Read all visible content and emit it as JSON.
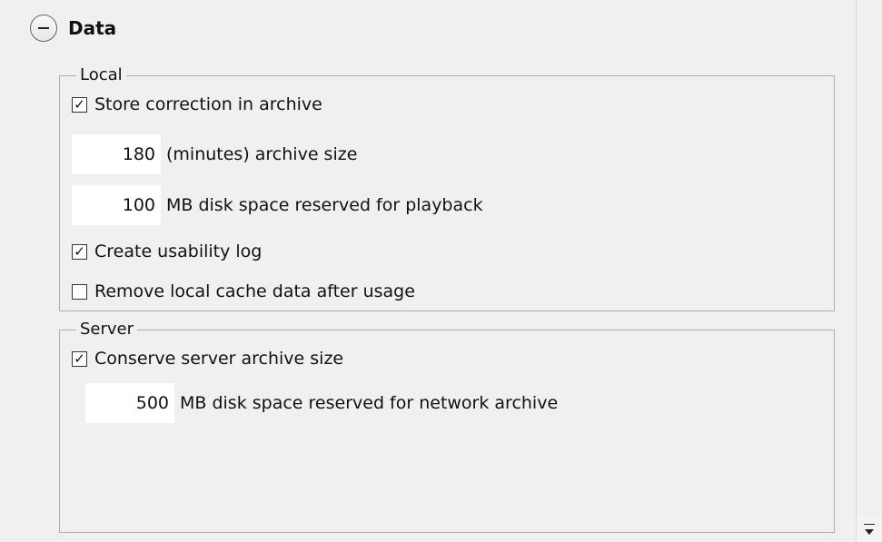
{
  "section": {
    "title": "Data",
    "collapse_icon": "minus-circle-icon"
  },
  "local": {
    "legend": "Local",
    "store_correction": {
      "label": "Store correction in archive",
      "checked": true
    },
    "archive_size": {
      "value": "180",
      "label": "(minutes) archive size"
    },
    "playback_space": {
      "value": "100",
      "label": "MB disk space reserved for playback"
    },
    "usability_log": {
      "label": "Create usability log",
      "checked": true
    },
    "remove_cache": {
      "label": "Remove local cache data after usage",
      "checked": false
    }
  },
  "server": {
    "legend": "Server",
    "conserve_archive": {
      "label": "Conserve server archive size",
      "checked": true
    },
    "network_archive": {
      "value": "500",
      "label": "MB disk space reserved for network archive"
    }
  },
  "scrollbar": {
    "down_icon": "scroll-down-arrow-icon"
  }
}
